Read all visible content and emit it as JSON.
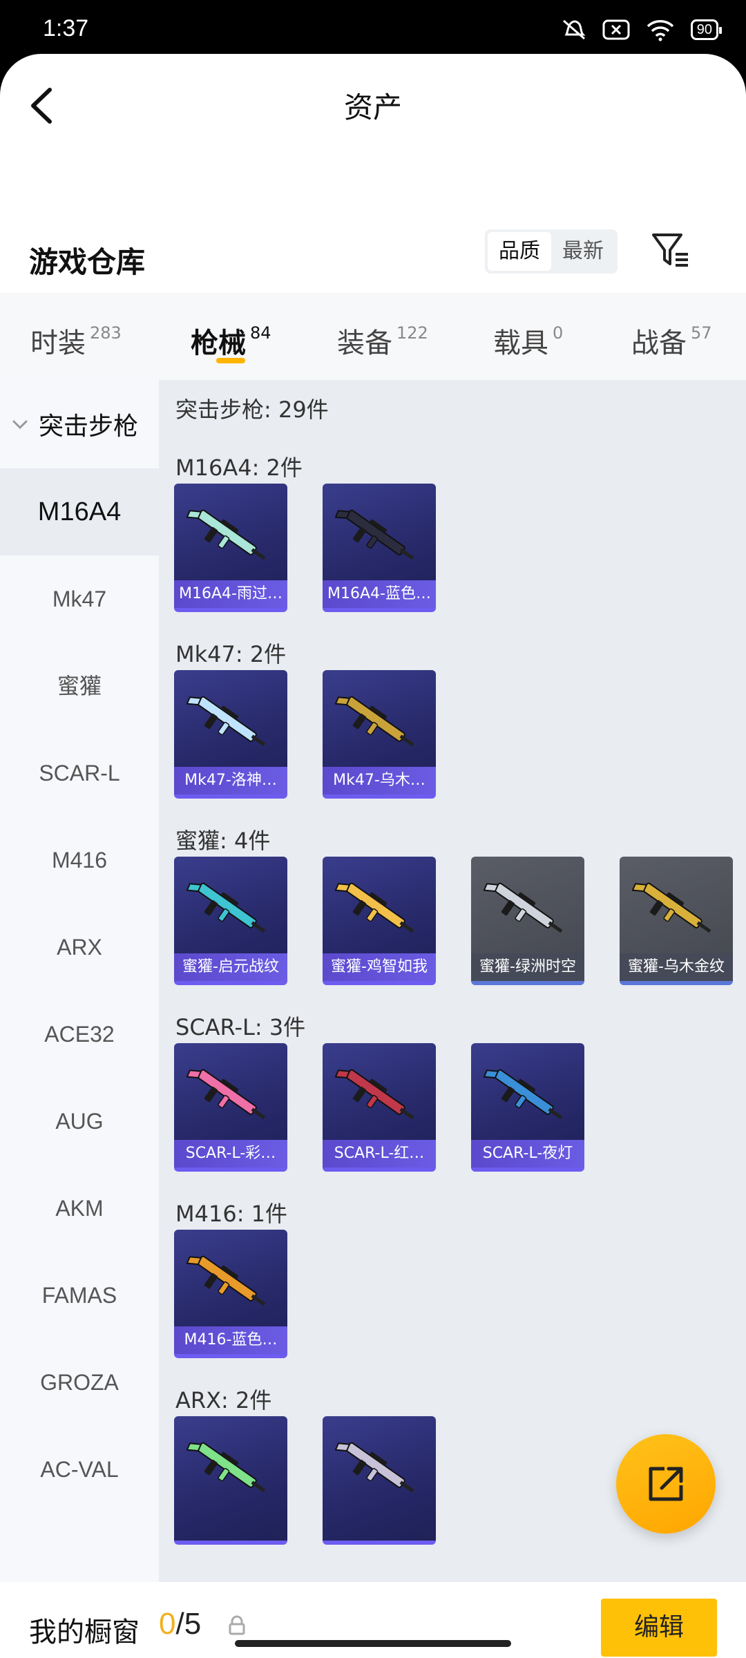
{
  "status_bar": {
    "time": "1:37",
    "battery": "90"
  },
  "nav": {
    "title": "资产"
  },
  "header": {
    "title": "游戏仓库",
    "sort_options": [
      "品质",
      "最新"
    ],
    "sort_selected": "品质"
  },
  "tabs": [
    {
      "label": "时装",
      "count": "283"
    },
    {
      "label": "枪械",
      "count": "84",
      "active": true
    },
    {
      "label": "装备",
      "count": "122"
    },
    {
      "label": "载具",
      "count": "0"
    },
    {
      "label": "战备",
      "count": "57"
    }
  ],
  "sidebar": {
    "group": "突击步枪",
    "items": [
      "M16A4",
      "Mk47",
      "蜜獾",
      "SCAR-L",
      "M416",
      "ARX",
      "ACE32",
      "AUG",
      "AKM",
      "FAMAS",
      "GROZA",
      "AC-VAL"
    ],
    "selected": "M16A4"
  },
  "content": {
    "total": "突击步枪: 29件",
    "sections": [
      {
        "header": "M16A4: 2件",
        "items": [
          {
            "name": "M16A4-雨过…",
            "style": "purple",
            "gun_color": "#a9e6d8"
          },
          {
            "name": "M16A4-蓝色…",
            "style": "purple",
            "gun_color": "#2b2d3f"
          }
        ]
      },
      {
        "header": "Mk47: 2件",
        "items": [
          {
            "name": "Mk47-洛神…",
            "style": "purple",
            "gun_color": "#bfe3ff"
          },
          {
            "name": "Mk47-乌木…",
            "style": "purple",
            "gun_color": "#c9a23a"
          }
        ]
      },
      {
        "header": "蜜獾: 4件",
        "items": [
          {
            "name": "蜜獾-启元战纹",
            "style": "purple",
            "gun_color": "#3fc4d2"
          },
          {
            "name": "蜜獾-鸡智如我",
            "style": "purple",
            "gun_color": "#f2c04a"
          },
          {
            "name": "蜜獾-绿洲时空",
            "style": "gray",
            "gun_color": "#cfd4dc"
          },
          {
            "name": "蜜獾-乌木金纹",
            "style": "gray",
            "gun_color": "#d9b13a"
          }
        ]
      },
      {
        "header": "SCAR-L: 3件",
        "items": [
          {
            "name": "SCAR-L-彩…",
            "style": "purple",
            "gun_color": "#ef6fa8"
          },
          {
            "name": "SCAR-L-红…",
            "style": "purple",
            "gun_color": "#c0384a"
          },
          {
            "name": "SCAR-L-夜灯",
            "style": "purple",
            "gun_color": "#3a8fd8"
          }
        ]
      },
      {
        "header": "M416: 1件",
        "items": [
          {
            "name": "M416-蓝色…",
            "style": "purple",
            "gun_color": "#e89a2a"
          }
        ]
      },
      {
        "header": "ARX: 2件",
        "items": [
          {
            "name": "",
            "style": "purple",
            "gun_color": "#7fe28a"
          },
          {
            "name": "",
            "style": "purple",
            "gun_color": "#c8c2d8"
          }
        ]
      }
    ]
  },
  "bottom_bar": {
    "label": "我的橱窗",
    "count_current": "0",
    "count_total": "/5",
    "edit_label": "编辑"
  },
  "colors": {
    "accent": "#ffc107",
    "card_purple": "#2a2c70",
    "caption_purple": "#6d5cf0"
  },
  "icons": [
    "back-arrow-icon",
    "filter-icon",
    "chevron-down-icon",
    "lock-icon",
    "share-icon"
  ]
}
